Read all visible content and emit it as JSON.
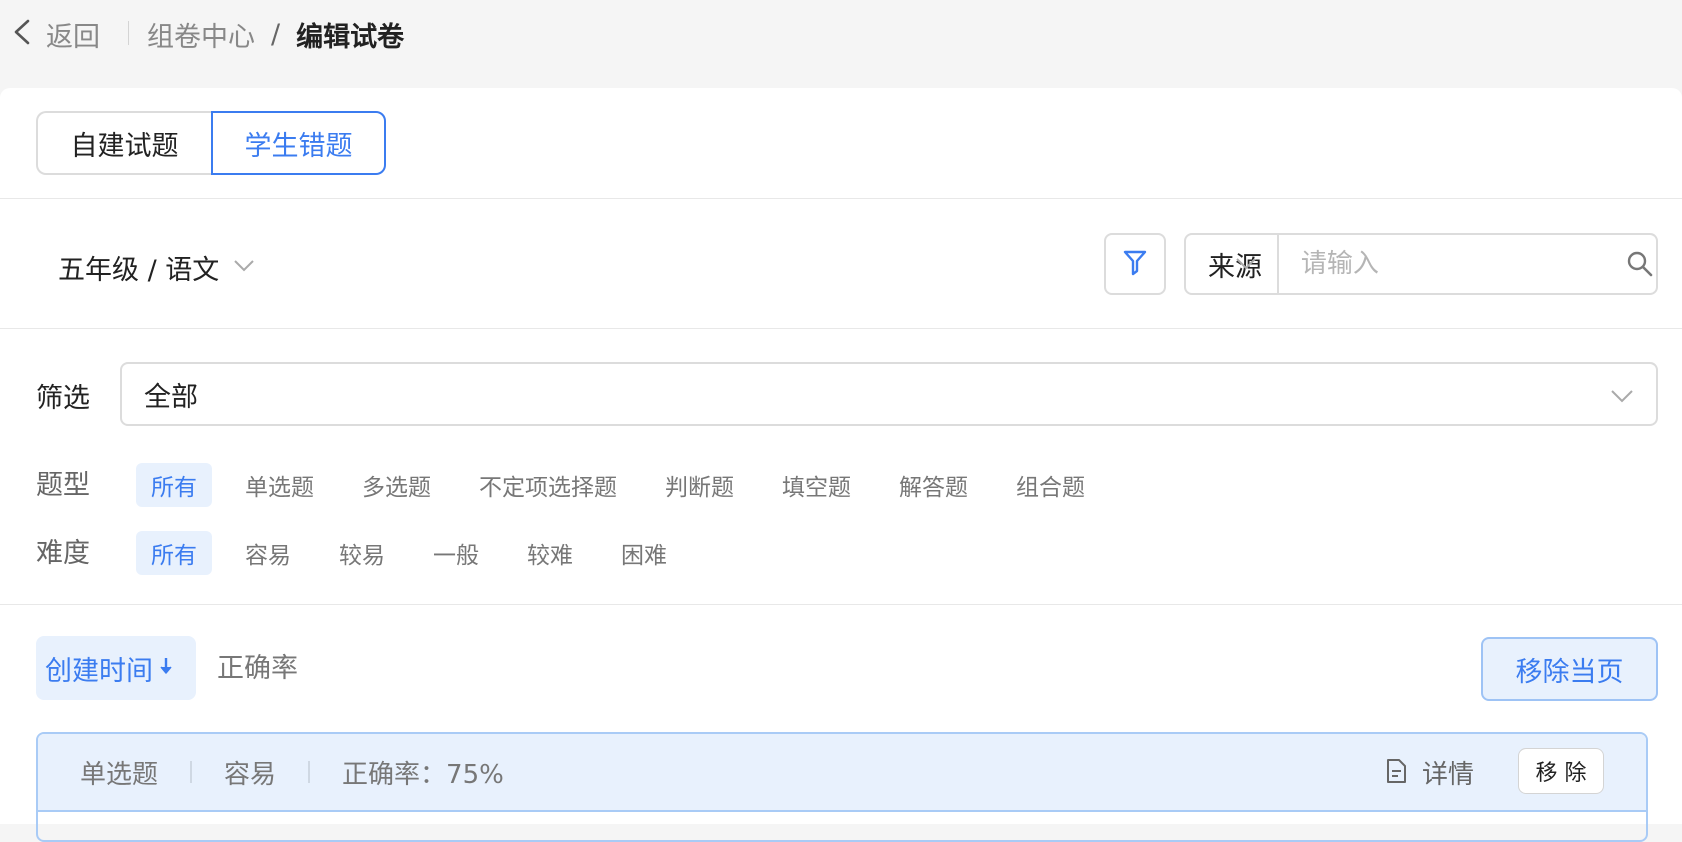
{
  "header": {
    "back_label": "返回",
    "breadcrumb_parent": "组卷中心",
    "breadcrumb_separator": "/",
    "breadcrumb_current": "编辑试卷"
  },
  "tabs": [
    {
      "label": "自建试题",
      "active": false
    },
    {
      "label": "学生错题",
      "active": true
    }
  ],
  "toolbar": {
    "grade_subject": "五年级 / 语文",
    "source_label": "来源",
    "search_placeholder": "请输入"
  },
  "filter": {
    "label": "筛选",
    "selected": "全部"
  },
  "question_types": {
    "label": "题型",
    "options": [
      "所有",
      "单选题",
      "多选题",
      "不定项选择题",
      "判断题",
      "填空题",
      "解答题",
      "组合题"
    ],
    "active_index": 0
  },
  "difficulty": {
    "label": "难度",
    "options": [
      "所有",
      "容易",
      "较易",
      "一般",
      "较难",
      "困难"
    ],
    "active_index": 0
  },
  "sort": {
    "created_time": "创建时间",
    "accuracy": "正确率"
  },
  "remove_page_label": "移除当页",
  "question": {
    "type": "单选题",
    "difficulty": "容易",
    "accuracy": "正确率：75%",
    "detail_label": "详情",
    "remove_label": "移 除"
  },
  "colors": {
    "accent": "#3b7cf0",
    "accent_bg": "#e8f1fd"
  }
}
